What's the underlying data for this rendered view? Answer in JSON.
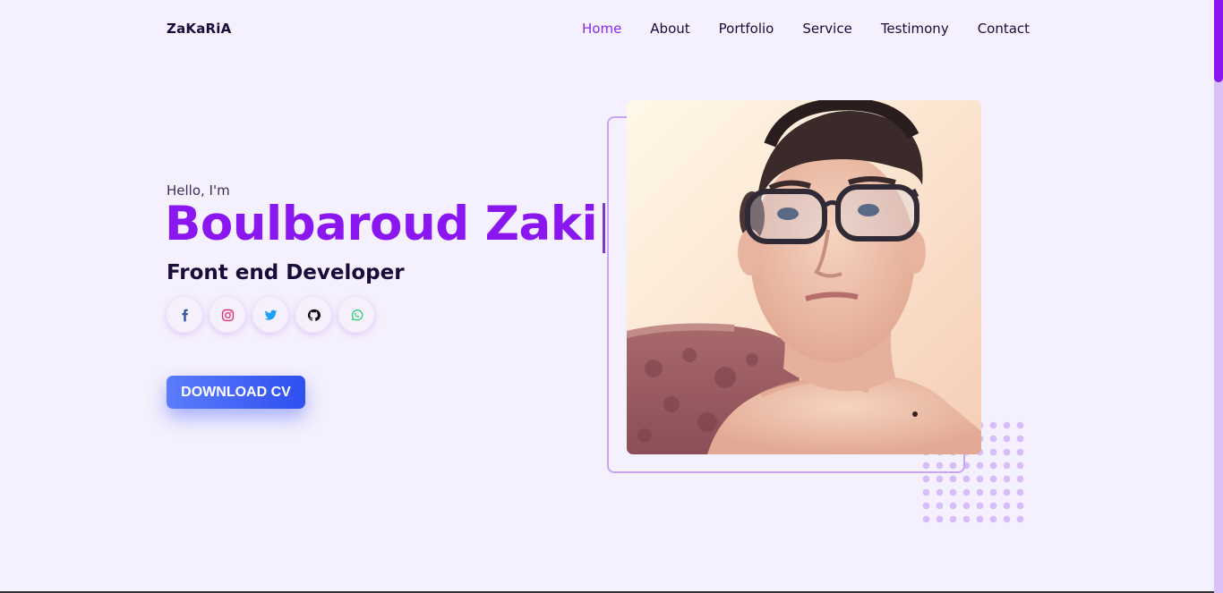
{
  "brand": {
    "logo": "ZaKaRiA"
  },
  "nav": {
    "items": [
      {
        "label": "Home",
        "active": true
      },
      {
        "label": "About",
        "active": false
      },
      {
        "label": "Portfolio",
        "active": false
      },
      {
        "label": "Service",
        "active": false
      },
      {
        "label": "Testimony",
        "active": false
      },
      {
        "label": "Contact",
        "active": false
      }
    ]
  },
  "hero": {
    "greeting": "Hello, I'm",
    "name": "Boulbaroud Zaki",
    "role": "Front end Developer",
    "cta_label": "DOWNLOAD CV",
    "socials": [
      {
        "icon": "facebook-icon",
        "color": "#3b5998"
      },
      {
        "icon": "instagram-icon",
        "color": "#e1306c"
      },
      {
        "icon": "twitter-icon",
        "color": "#1da1f2"
      },
      {
        "icon": "github-icon",
        "color": "#111111"
      },
      {
        "icon": "whatsapp-icon",
        "color": "#25d366"
      }
    ]
  },
  "colors": {
    "accent": "#8a17f0",
    "background": "#f5f0fd",
    "button": "#3d5cf5"
  }
}
